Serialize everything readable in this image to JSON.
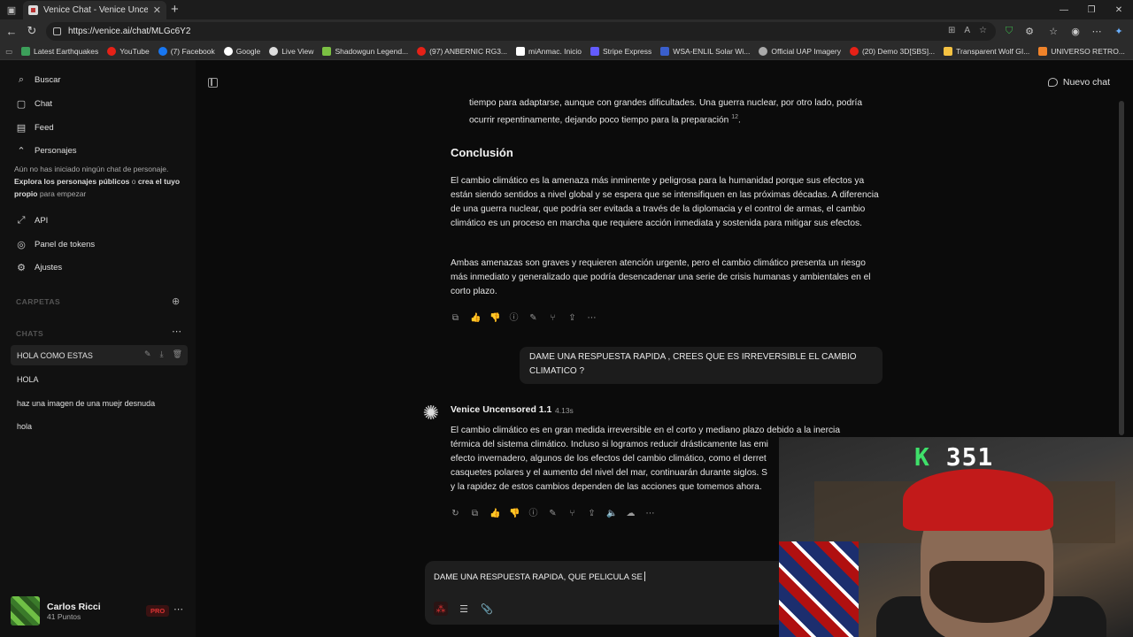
{
  "browser": {
    "tab_title": "Venice Chat - Venice Uncensored",
    "url": "https://venice.ai/chat/MLGc6Y2",
    "bookmarks": [
      {
        "label": "Latest Earthquakes",
        "color": "#3c9f5a"
      },
      {
        "label": "YouTube",
        "color": "#e62117"
      },
      {
        "label": "(7) Facebook",
        "color": "#1877f2"
      },
      {
        "label": "Google",
        "color": "#ffffff"
      },
      {
        "label": "Live View",
        "color": "#dddddd"
      },
      {
        "label": "Shadowgun Legend...",
        "color": "#7bc043"
      },
      {
        "label": "(97) ANBERNIC RG3...",
        "color": "#e62117"
      },
      {
        "label": "miAnmac. Inicio",
        "color": "#ffffff"
      },
      {
        "label": "Stripe Express",
        "color": "#635bff"
      },
      {
        "label": "WSA-ENLIL Solar Wi...",
        "color": "#3a5fcd"
      },
      {
        "label": "Official UAP Imagery",
        "color": "#aaaaaa"
      },
      {
        "label": "(20) Demo 3D[SBS]...",
        "color": "#e62117"
      },
      {
        "label": "Transparent Wolf GI...",
        "color": "#f5c242"
      },
      {
        "label": "UNIVERSO RETRO...",
        "color": "#f0832a"
      }
    ]
  },
  "sidebar": {
    "search": "Buscar",
    "chat": "Chat",
    "feed": "Feed",
    "personas": "Personajes",
    "persona_text_1": "Aún no has iniciado ningún chat de personaje.",
    "persona_link_1": "Explora los personajes públicos",
    "persona_or": " o ",
    "persona_link_2": "crea el tuyo propio",
    "persona_tail": " para empezar",
    "api": "API",
    "tokens": "Panel de tokens",
    "settings": "Ajustes",
    "folders_label": "CARPETAS",
    "chats_label": "CHATS",
    "chats": [
      "HOLA COMO ESTAS",
      "HOLA",
      "haz una imagen de una muejr desnuda",
      "hola"
    ],
    "user_name": "Carlos Ricci",
    "user_points": "41 Puntos",
    "badge": "PRO"
  },
  "header": {
    "new_chat": "Nuevo chat"
  },
  "conversation": {
    "prev_tail_1": "tiempo para adaptarse, aunque con grandes dificultades. Una guerra nuclear, por otro lado, podría",
    "prev_tail_2": "ocurrir repentinamente, dejando poco tiempo para la preparación",
    "prev_sup": "12",
    "conclusion_heading": "Conclusión",
    "conclusion_p1": "El cambio climático es la amenaza más inminente y peligrosa para la humanidad porque sus efectos ya están siendo sentidos a nivel global y se espera que se intensifiquen en las próximas décadas. A diferencia de una guerra nuclear, que podría ser evitada a través de la diplomacia y el control de armas, el cambio climático es un proceso en marcha que requiere acción inmediata y sostenida para mitigar sus efectos.",
    "conclusion_p2": "Ambas amenazas son graves y requieren atención urgente, pero el cambio climático presenta un riesgo más inmediato y generalizado que podría desencadenar una serie de crisis humanas y ambientales en el corto plazo.",
    "user_message": "DAME UNA RESPUESTA RAPIDA , CREES QUE ES IRREVERSIBLE EL CAMBIO CLIMATICO ?",
    "model_name": "Venice Uncensored 1.1",
    "model_time": "4.13s",
    "reply_l1": "El cambio climático es en gran medida irreversible en el corto y mediano plazo debido a la inercia",
    "reply_l2": "térmica del sistema climático. Incluso si logramos reducir drásticamente las emi",
    "reply_l3": "efecto invernadero, algunos de los efectos del cambio climático, como el derret",
    "reply_l4": "casquetes polares y el aumento del nivel del mar, continuarán durante siglos. S",
    "reply_l5": "y la rapidez de estos cambios dependen de las acciones que tomemos ahora."
  },
  "composer": {
    "value": "DAME UNA RESPUESTA RAPIDA, QUE PELICULA SE"
  },
  "overlay": {
    "badge_k": "K",
    "badge_num": "351"
  }
}
